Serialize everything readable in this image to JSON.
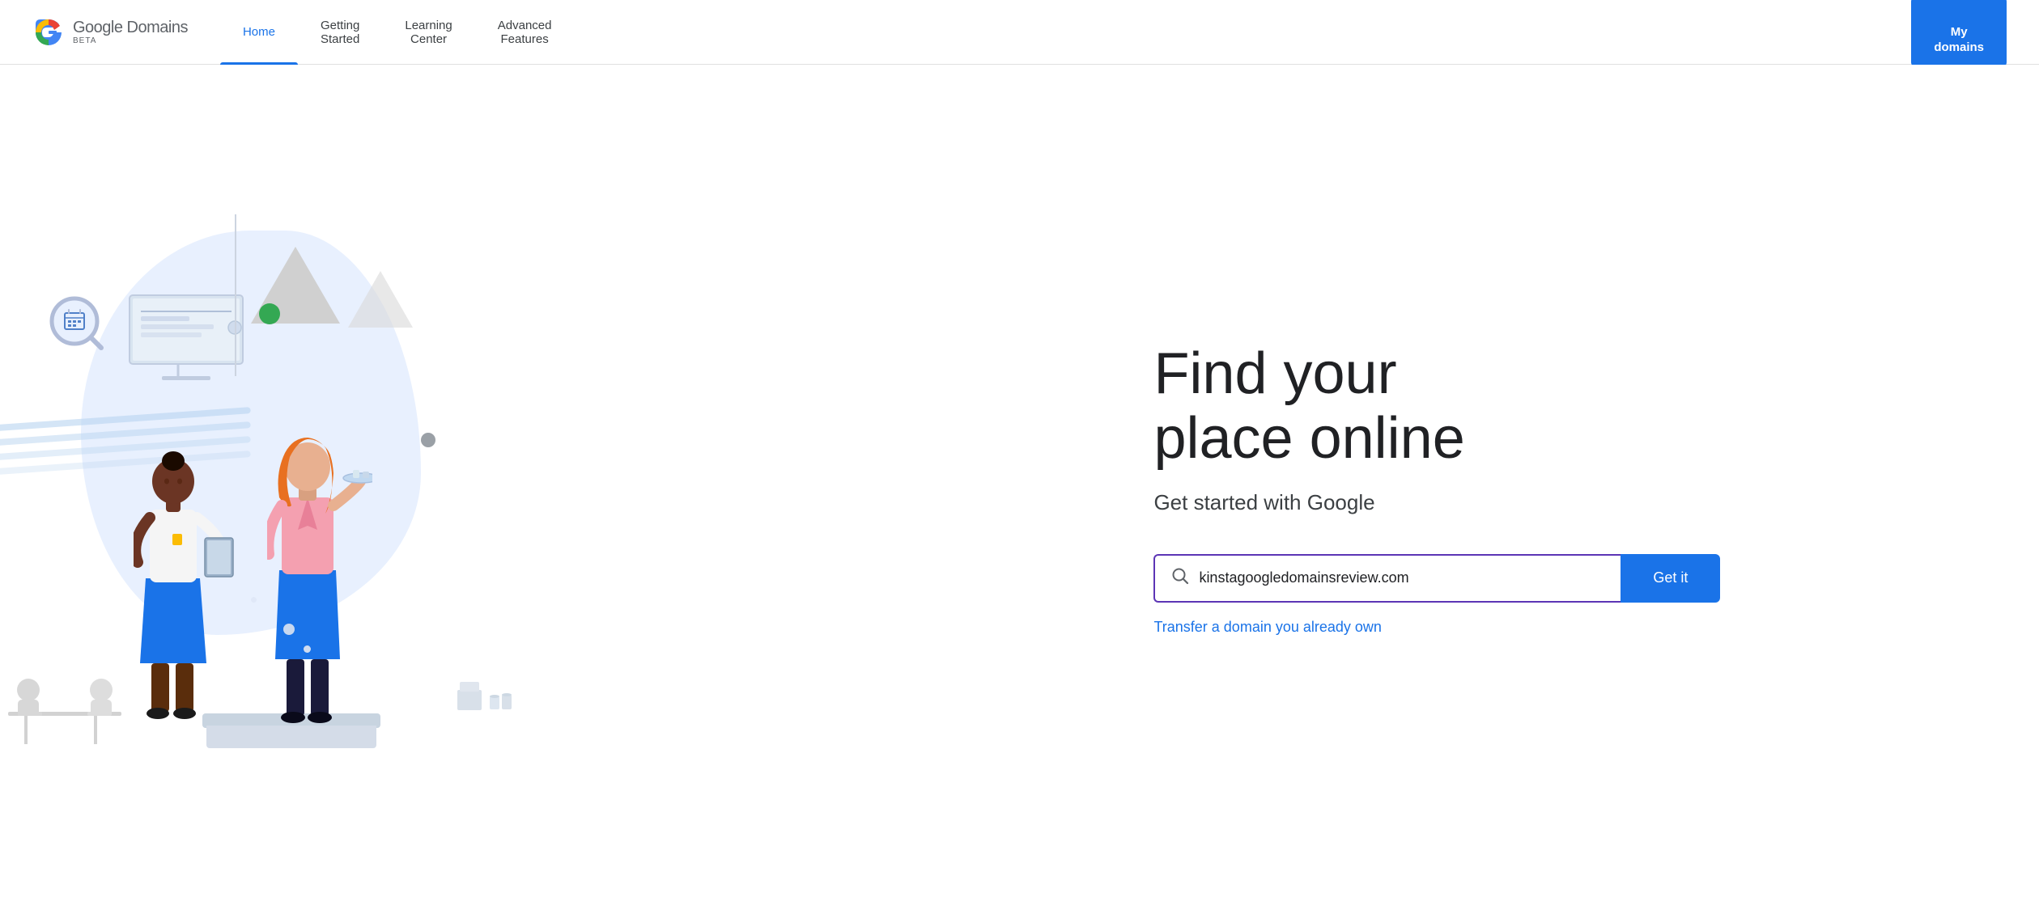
{
  "header": {
    "logo_text": "Google Domains",
    "logo_beta": "BETA",
    "nav_items": [
      {
        "label": "Home",
        "active": true
      },
      {
        "label": "Getting\nStarted",
        "active": false
      },
      {
        "label": "Learning\nCenter",
        "active": false
      },
      {
        "label": "Advanced\nFeatures",
        "active": false
      }
    ],
    "my_domains_label": "My\ndomains"
  },
  "hero": {
    "headline_line1": "Find your",
    "headline_line2": "place online",
    "subheadline": "Get started with Google",
    "search_placeholder": "kinstagoogledomainsreview.com",
    "search_value": "kinstagoogledomainsreview.com",
    "get_it_label": "Get it",
    "transfer_label": "Transfer a domain you already own"
  },
  "icons": {
    "search": "🔍",
    "google_logo_colors": [
      "#4285F4",
      "#EA4335",
      "#FBBC05",
      "#34A853"
    ]
  }
}
